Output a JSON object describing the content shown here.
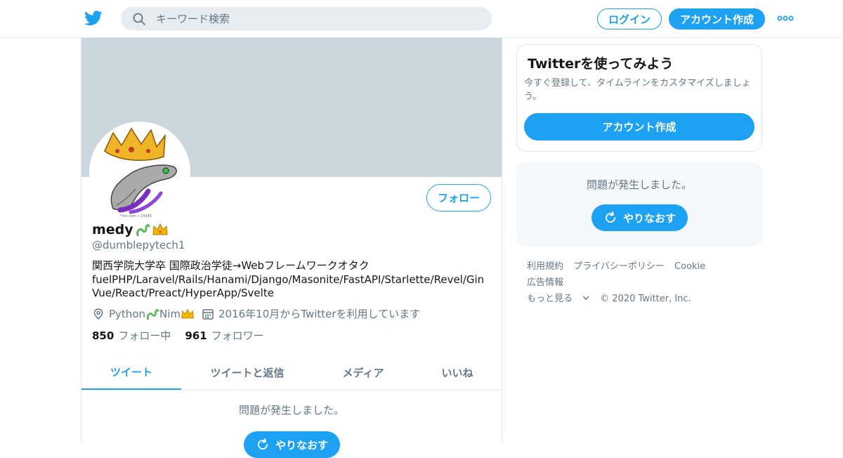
{
  "header": {
    "search_placeholder": "キーワード検索",
    "login_label": "ログイン",
    "signup_label": "アカウント作成"
  },
  "profile": {
    "name": "medy",
    "handle": "@dumblepytech1",
    "follow_label": "フォロー",
    "bio_lines": [
      "関西学院大学卒 国際政治学徒→Webフレームワークオタク",
      "fuelPHP/Laravel/Rails/Hanami/Django/Masonite/FastAPI/Starlette/Revel/Gin",
      "Vue/React/Preact/HyperApp/Svelte"
    ],
    "location_a": "Python",
    "location_b": "Nim",
    "joined": "2016年10月からTwitterを利用しています",
    "following_count": "850",
    "following_label": "フォロー中",
    "followers_count": "961",
    "followers_label": "フォロワー"
  },
  "tabs": [
    {
      "label": "ツイート",
      "active": true
    },
    {
      "label": "ツイートと返信",
      "active": false
    },
    {
      "label": "メディア",
      "active": false
    },
    {
      "label": "いいね",
      "active": false
    }
  ],
  "timeline": {
    "error_text": "問題が発生しました。",
    "retry_label": "やりなおす"
  },
  "sidebar": {
    "signup_card": {
      "title": "Twitterを使ってみよう",
      "description": "今すぐ登録して、タイムラインをカスタマイズしましょう。",
      "button_label": "アカウント作成"
    },
    "trends_card": {
      "error_text": "問題が発生しました。",
      "retry_label": "やりなおす"
    },
    "footer": {
      "terms": "利用規約",
      "privacy": "プライバシーポリシー",
      "cookie": "Cookie",
      "ads": "広告情報",
      "more": "もっと見る",
      "copyright": "© 2020 Twitter, Inc."
    }
  },
  "colors": {
    "accent": "#1da1f2",
    "banner": "#ccd6dd",
    "muted_text": "#657786"
  },
  "icons": [
    "twitter-logo-icon",
    "search-icon",
    "more-dots-icon",
    "location-icon",
    "calendar-icon",
    "refresh-icon",
    "chevron-down-icon",
    "snake-emoji-icon",
    "crown-emoji-icon"
  ]
}
